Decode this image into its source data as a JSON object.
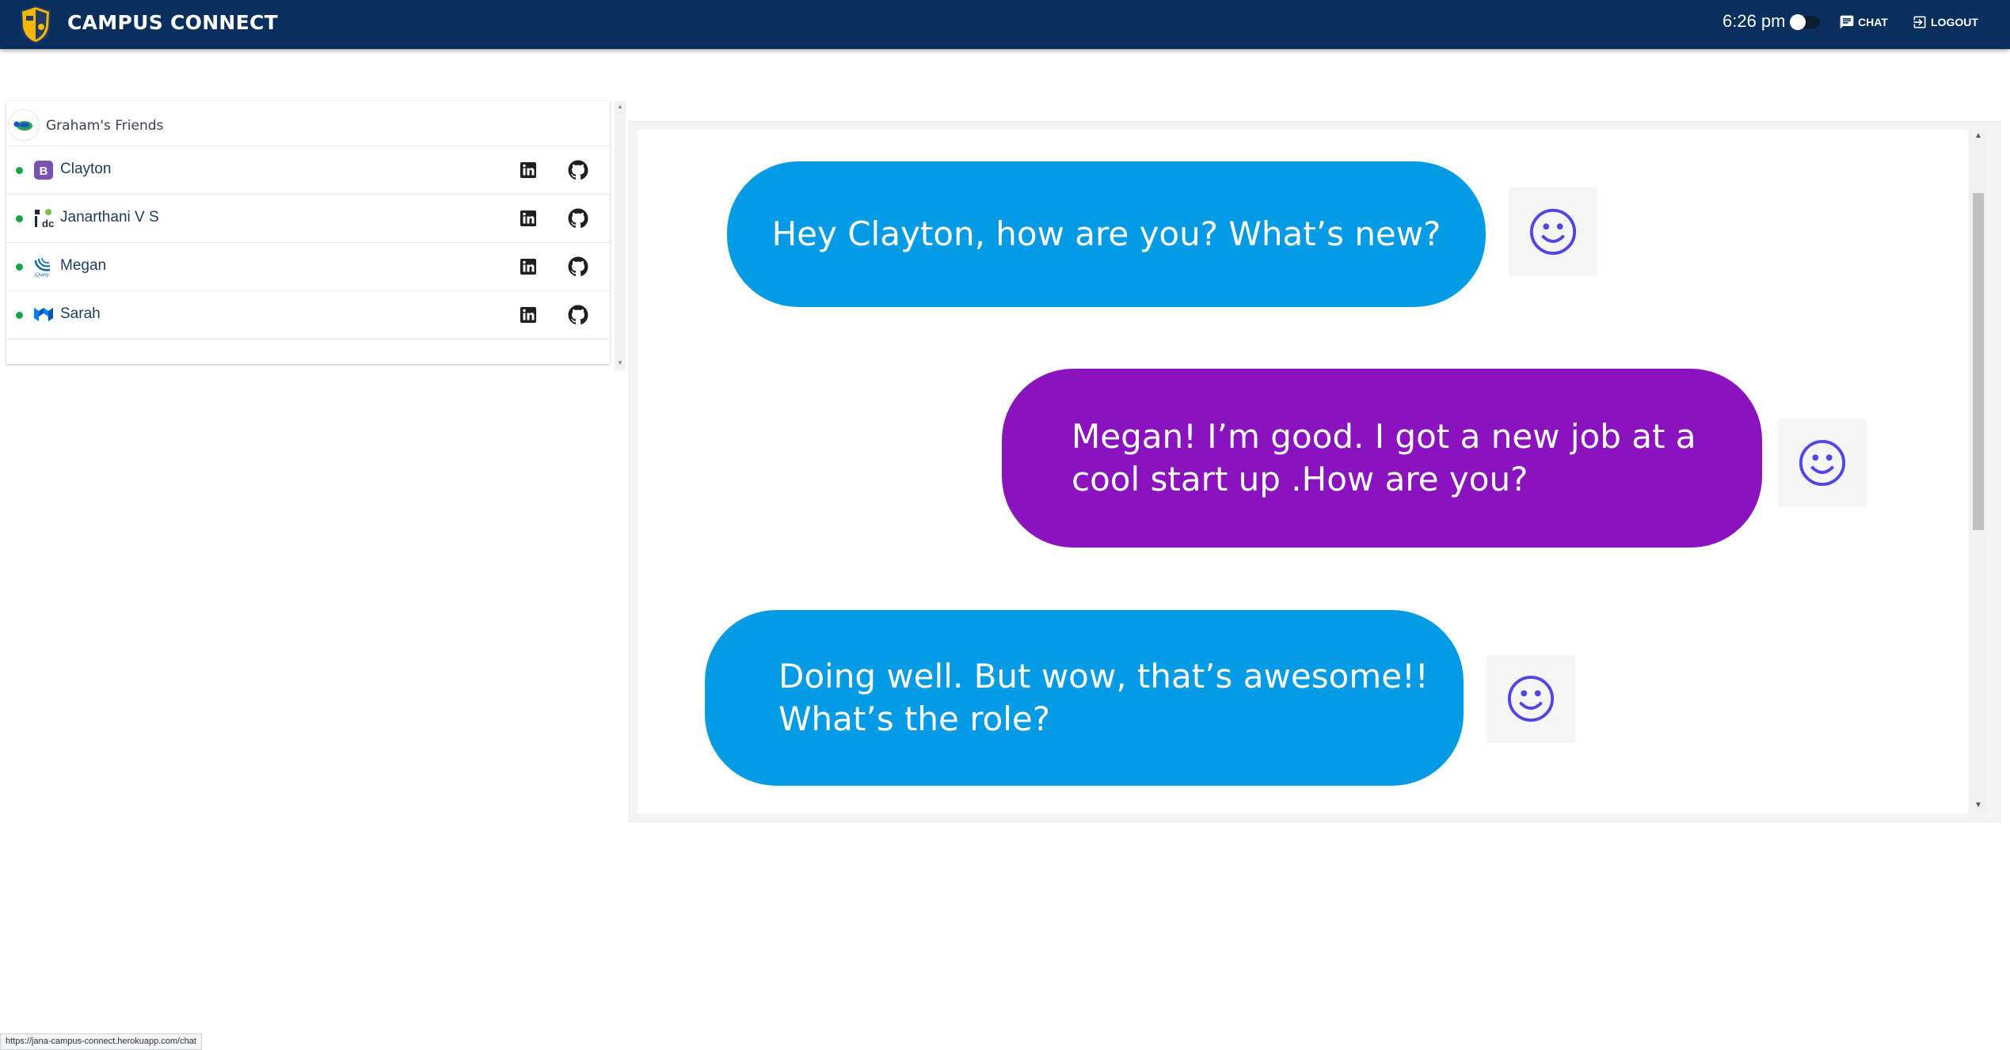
{
  "topbar": {
    "brand": "CAMPUS CONNECT",
    "time": "6:26 pm",
    "chat_label": "CHAT",
    "logout_label": "LOGOUT"
  },
  "friends": {
    "group_name": "Graham's Friends",
    "items": [
      {
        "name": "Clayton",
        "status": "online",
        "avatar_icon": "bootstrap-icon"
      },
      {
        "name": "Janarthani V S",
        "status": "online",
        "avatar_icon": "django-icon"
      },
      {
        "name": "Megan",
        "status": "online",
        "avatar_icon": "jquery-icon"
      },
      {
        "name": "Sarah",
        "status": "online",
        "avatar_icon": "mui-icon"
      }
    ]
  },
  "chat": {
    "messages": [
      {
        "text": "Hey Clayton, how are you? What’s new?",
        "color": "#039be5"
      },
      {
        "text_line1": "Megan!  I’m good. I got a new job at a",
        "text_line2": "cool start up .How are you?",
        "color": "#8a13bf"
      },
      {
        "text_line1": "Doing well. But wow, that’s awesome!!",
        "text_line2": "What’s the role?",
        "color": "#039be5"
      }
    ]
  },
  "status_bar": {
    "url": "https://jana-campus-connect.herokuapp.com/chat"
  },
  "colors": {
    "topbar": "#082f5e",
    "online": "#16a34a",
    "bubble_blue": "#039be5",
    "bubble_purple": "#8a13bf"
  }
}
